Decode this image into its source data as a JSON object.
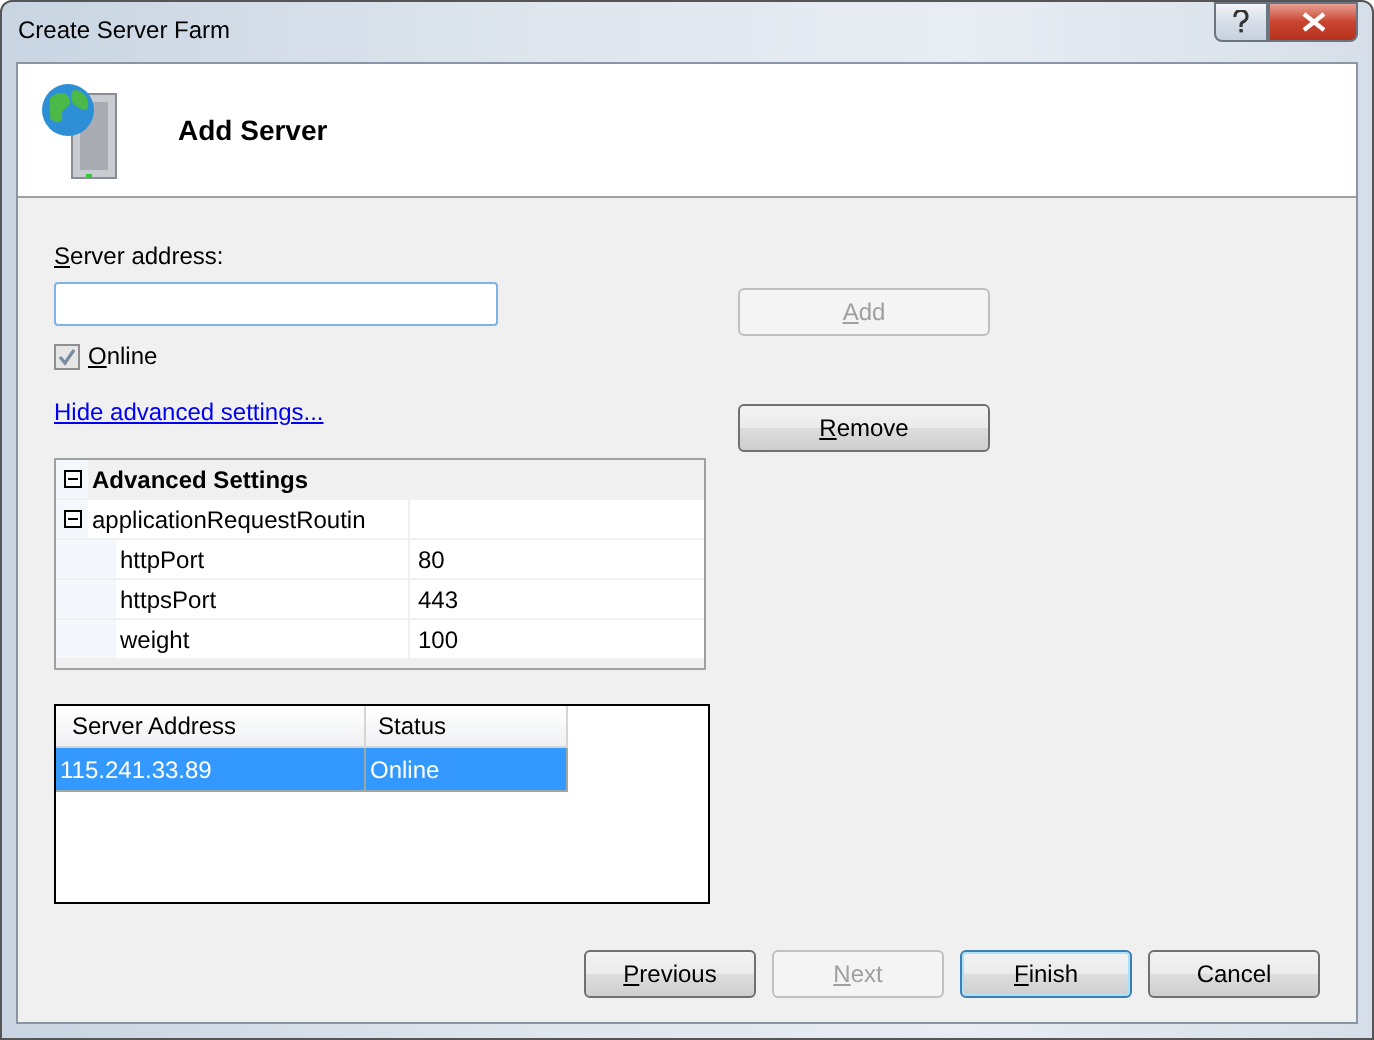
{
  "window": {
    "title": "Create Server Farm"
  },
  "header": {
    "title": "Add Server"
  },
  "server_address": {
    "label": "Server address:",
    "access_key": true
  },
  "online": {
    "label": "Online",
    "access_key": true,
    "checked": true,
    "disabled": true
  },
  "advanced_link": "Hide advanced settings...",
  "advanced_settings": {
    "title": "Advanced Settings",
    "expanded": true,
    "children": [
      {
        "name": "applicationRequestRoutin",
        "expanded": true,
        "children": [
          {
            "name": "httpPort",
            "value": "80"
          },
          {
            "name": "httpsPort",
            "value": "443"
          },
          {
            "name": "weight",
            "value": "100"
          }
        ]
      }
    ]
  },
  "servers": {
    "columns": [
      "Server Address",
      "Status"
    ],
    "rows": [
      {
        "cells": [
          "115.241.33.89",
          "Online"
        ],
        "selected": true
      }
    ]
  },
  "side_buttons": [
    {
      "label": "Add",
      "access_key": true,
      "disabled": true
    },
    {
      "label": "Remove",
      "access_key": true,
      "disabled": false
    }
  ],
  "footer_buttons": [
    {
      "label": "Previous",
      "access_key": true,
      "disabled": false,
      "default": false
    },
    {
      "label": "Next",
      "access_key": true,
      "disabled": true,
      "default": false
    },
    {
      "label": "Finish",
      "access_key": true,
      "disabled": false,
      "default": true
    },
    {
      "label": "Cancel",
      "access_key": false,
      "disabled": false,
      "default": false
    }
  ]
}
